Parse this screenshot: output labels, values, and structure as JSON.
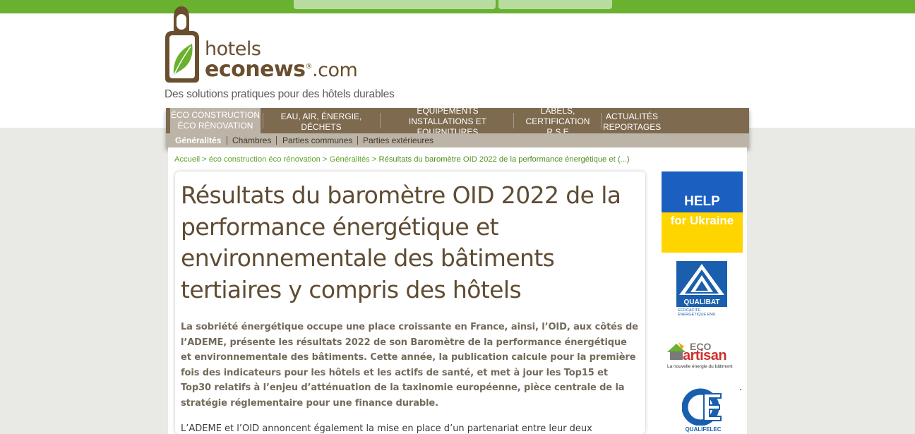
{
  "site": {
    "logo_word_1": "hotels",
    "logo_word_2": "econews",
    "logo_registered": "®",
    "logo_suffix": ".com",
    "tagline": "Des solutions pratiques pour des hôtels durables"
  },
  "colors": {
    "top_bar": "#69b12f",
    "nav_bg": "#7e6a4f",
    "nav_active": "#bdb4a8",
    "title": "#5f4c33",
    "chapo": "#736a5a",
    "breadcrumb": "#5ea328"
  },
  "nav": {
    "items": [
      {
        "line1": "ÉCO CONSTRUCTION",
        "line2": "ÉCO RÉNOVATION"
      },
      {
        "line1": "EAU, AIR, ÉNERGIE, DÉCHETS",
        "line2": ""
      },
      {
        "line1": "EQUIPEMENTS",
        "line2": "INSTALLATIONS ET FOURNITURES"
      },
      {
        "line1": "LABELS,",
        "line2": "CERTIFICATION R.S.E"
      },
      {
        "line1": "ACTUALITÉS",
        "line2": "REPORTAGES"
      }
    ],
    "sub_items": [
      "Généralités",
      "Chambres",
      "Parties communes",
      "Parties extérieures"
    ]
  },
  "breadcrumb": {
    "home": "Accueil",
    "sep": " > ",
    "section": "éco construction éco rénovation",
    "subsection": "Généralités",
    "current": "Résultats du baromètre OID 2022 de la performance énergétique et (...)"
  },
  "article": {
    "title": "Résultats du baromètre OID 2022 de la performance énergétique et environnementale des bâtiments tertiaires y compris des hôtels",
    "chapo": "La sobriété énergétique occupe une place croissante en France, ainsi, l’OID, aux côtés de l’ADEME, présente les résultats 2022 de son Baromètre de la performance énergétique et environnementale des bâtiments. Cette année, la publication calcule pour la première fois des indicateurs pour les hôtels et les actifs de santé, et met à jour les Top15 et Top30 relatifs à l’enjeu d’atténuation de la taxinomie européenne, pièce centrale de la stratégie réglementaire pour une finance durable.",
    "body_start": "L’ADEME et l’OID annoncent également la mise en place d’un partenariat entre leur deux"
  },
  "sidebar": {
    "ukraine_line1": "HELP",
    "ukraine_line2": "for Ukraine",
    "qualibat_label": "QUALIBAT",
    "qualibat_small_1": "EFFICACITÉ",
    "qualibat_small_2": "ÉNERGÉTIQUE",
    "qualibat_small_3": "ENR",
    "ecoartisan_eco": "ECO",
    "ecoartisan_artisan": "artisan",
    "ecoartisan_tagline": "La nouvelle énergie du bâtiment",
    "qualifelec_name": "QUALIFELEC"
  }
}
